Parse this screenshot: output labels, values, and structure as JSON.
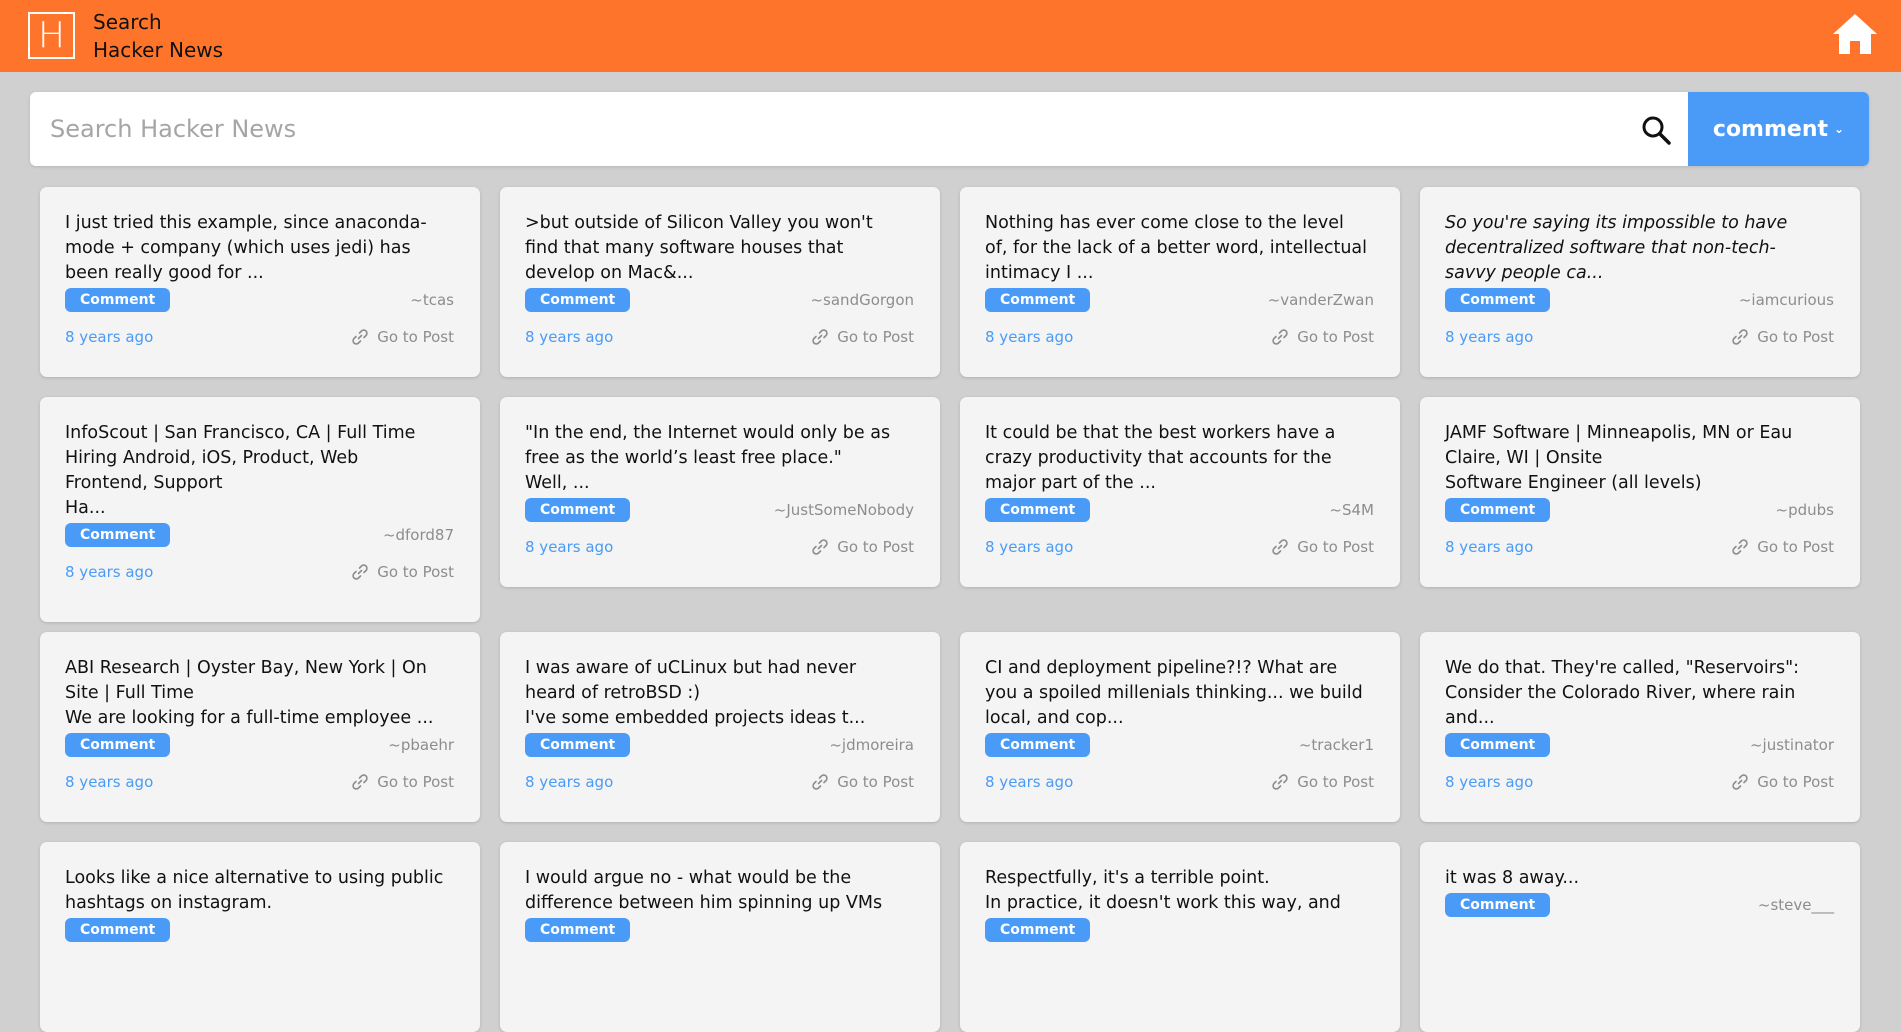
{
  "header": {
    "logo_letter": "H",
    "title_line1": "Search",
    "title_line2": "Hacker News"
  },
  "search": {
    "placeholder": "Search Hacker News",
    "value": "",
    "type_label": "comment"
  },
  "colors": {
    "brand": "#ff742b",
    "accent": "#4a9bf7",
    "background": "#d0d0d0",
    "card": "#f4f4f4"
  },
  "icons": {
    "home": "home-icon",
    "search": "search-icon",
    "link": "link-icon",
    "dropdown": "chevron-down-icon"
  },
  "cards": [
    {
      "text": "I just tried this example, since anaconda-\nmode + company (which uses jedi) has\nbeen really good for ...",
      "italic": false,
      "badge": "Comment",
      "author": "~tcas",
      "time": "8 years ago",
      "link": "Go to Post"
    },
    {
      "text": ">but outside of Silicon Valley you won't\nfind that many software houses that\ndevelop on Mac&...",
      "italic": false,
      "badge": "Comment",
      "author": "~sandGorgon",
      "time": "8 years ago",
      "link": "Go to Post"
    },
    {
      "text": "Nothing has ever come close to the level\nof, for the lack of a better word, intellectual\nintimacy I ...",
      "italic": false,
      "badge": "Comment",
      "author": "~vanderZwan",
      "time": "8 years ago",
      "link": "Go to Post"
    },
    {
      "text": "So you're saying its impossible to have\ndecentralized software that non-tech-\nsavvy people ca...",
      "italic": true,
      "badge": "Comment",
      "author": "~iamcurious",
      "time": "8 years ago",
      "link": "Go to Post"
    },
    {
      "text": "InfoScout | San Francisco, CA | Full Time\nHiring Android, iOS, Product, Web\nFrontend, Support\nHa...",
      "italic": false,
      "badge": "Comment",
      "author": "~dford87",
      "time": "8 years ago",
      "link": "Go to Post"
    },
    {
      "text": "\"In the end, the Internet would only be as\nfree as the world’s least free place.\"\nWell, ...",
      "italic": false,
      "badge": "Comment",
      "author": "~JustSomeNobody",
      "time": "8 years ago",
      "link": "Go to Post"
    },
    {
      "text": "It could be that the best workers have a\ncrazy productivity that accounts for the\nmajor part of the ...",
      "italic": false,
      "badge": "Comment",
      "author": "~S4M",
      "time": "8 years ago",
      "link": "Go to Post"
    },
    {
      "text": "JAMF Software | Minneapolis, MN or Eau\nClaire, WI | Onsite\nSoftware Engineer (all levels)",
      "italic": false,
      "badge": "Comment",
      "author": "~pdubs",
      "time": "8 years ago",
      "link": "Go to Post"
    },
    {
      "text": "ABI Research | Oyster Bay, New York | On\nSite | Full Time\nWe are looking for a full-time employee ...",
      "italic": false,
      "badge": "Comment",
      "author": "~pbaehr",
      "time": "8 years ago",
      "link": "Go to Post"
    },
    {
      "text": "I was aware of uCLinux but had never\nheard of retroBSD :)\nI've some embedded projects ideas t...",
      "italic": false,
      "badge": "Comment",
      "author": "~jdmoreira",
      "time": "8 years ago",
      "link": "Go to Post"
    },
    {
      "text": "CI and deployment pipeline?!? What are\nyou a spoiled millenials thinking... we build\nlocal, and cop...",
      "italic": false,
      "badge": "Comment",
      "author": "~tracker1",
      "time": "8 years ago",
      "link": "Go to Post"
    },
    {
      "text": "We do that. They're called, \"Reservoirs\":\nConsider the Colorado River, where rain\nand...",
      "italic": false,
      "badge": "Comment",
      "author": "~justinator",
      "time": "8 years ago",
      "link": "Go to Post"
    },
    {
      "text": "Looks like a nice alternative to using public\nhashtags on instagram.",
      "italic": false,
      "badge": "Comment",
      "author": "",
      "time": "",
      "link": ""
    },
    {
      "text": "I would argue no - what would be the\ndifference between him spinning up VMs",
      "italic": false,
      "badge": "Comment",
      "author": "",
      "time": "",
      "link": ""
    },
    {
      "text": "Respectfully, it's a terrible point.\nIn practice, it doesn't work this way, and",
      "italic": false,
      "badge": "Comment",
      "author": "",
      "time": "",
      "link": ""
    },
    {
      "text": "it was 8 away...",
      "italic": false,
      "badge": "Comment",
      "author": "~steve___",
      "time": "",
      "link": ""
    }
  ]
}
